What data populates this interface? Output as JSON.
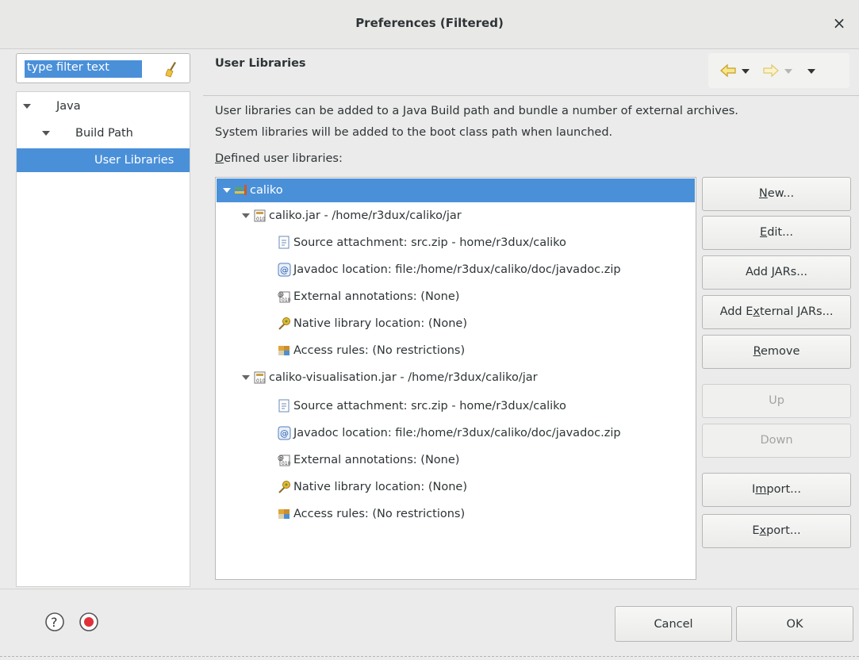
{
  "window": {
    "title": "Preferences (Filtered)",
    "close_glyph": "×"
  },
  "filter": {
    "placeholder": "type filter text",
    "value": "type filter text",
    "icon": "broom-icon"
  },
  "nav_tree": [
    {
      "label": "Java",
      "expanded": true
    },
    {
      "label": "Build Path",
      "expanded": true
    },
    {
      "label": "User Libraries",
      "selected": true
    }
  ],
  "page": {
    "title": "User Libraries",
    "description_line1": "User libraries can be added to a Java Build path and bundle a number of external archives.",
    "description_line2": "System libraries will be added to the boot class path when launched.",
    "defined_label_first": "D",
    "defined_label_rest": "efined user libraries:"
  },
  "toolbar": {
    "back_icon": "back-arrow-icon",
    "forward_icon": "forward-arrow-icon",
    "menu_icon": "view-menu-icon"
  },
  "libraries": [
    {
      "label": "caliko",
      "level": 0,
      "icon": "library-icon",
      "selected": true
    },
    {
      "label": "caliko.jar - /home/r3dux/caliko/jar",
      "level": 1,
      "icon": "jar-icon"
    },
    {
      "label": "Source attachment: src.zip - home/r3dux/caliko",
      "level": 2,
      "icon": "source-attachment-icon"
    },
    {
      "label": "Javadoc location: file:/home/r3dux/caliko/doc/javadoc.zip",
      "level": 2,
      "icon": "javadoc-icon"
    },
    {
      "label": "External annotations: (None)",
      "level": 2,
      "icon": "annotations-icon"
    },
    {
      "label": "Native library location: (None)",
      "level": 2,
      "icon": "native-library-icon"
    },
    {
      "label": "Access rules: (No restrictions)",
      "level": 2,
      "icon": "access-rules-icon"
    },
    {
      "label": "caliko-visualisation.jar - /home/r3dux/caliko/jar",
      "level": 1,
      "icon": "jar-icon"
    },
    {
      "label": "Source attachment: src.zip - home/r3dux/caliko",
      "level": 2,
      "icon": "source-attachment-icon"
    },
    {
      "label": "Javadoc location: file:/home/r3dux/caliko/doc/javadoc.zip",
      "level": 2,
      "icon": "javadoc-icon"
    },
    {
      "label": "External annotations: (None)",
      "level": 2,
      "icon": "annotations-icon"
    },
    {
      "label": "Native library location: (None)",
      "level": 2,
      "icon": "native-library-icon"
    },
    {
      "label": "Access rules: (No restrictions)",
      "level": 2,
      "icon": "access-rules-icon"
    }
  ],
  "buttons": {
    "new": {
      "pre": "",
      "u": "N",
      "post": "ew...",
      "enabled": true
    },
    "edit": {
      "pre": "",
      "u": "E",
      "post": "dit...",
      "enabled": true
    },
    "add_jars": {
      "pre": "Add ",
      "u": "J",
      "post": "ARs...",
      "enabled": true
    },
    "add_external_jars": {
      "pre": "Add E",
      "u": "x",
      "post": "ternal JARs...",
      "enabled": true
    },
    "remove": {
      "pre": "",
      "u": "R",
      "post": "emove",
      "enabled": true
    },
    "up": {
      "pre": "",
      "u": "",
      "post": "Up",
      "enabled": false
    },
    "down": {
      "pre": "",
      "u": "",
      "post": "Down",
      "enabled": false
    },
    "import": {
      "pre": "I",
      "u": "m",
      "post": "port...",
      "enabled": true
    },
    "export": {
      "pre": "E",
      "u": "x",
      "post": "port...",
      "enabled": true
    }
  },
  "footer": {
    "cancel": "Cancel",
    "ok": "OK",
    "help_icon": "help-icon",
    "record_icon": "record-icon"
  },
  "colors": {
    "selection": "#4a90d9",
    "background": "#ebebeb",
    "record": "#e0303a"
  }
}
